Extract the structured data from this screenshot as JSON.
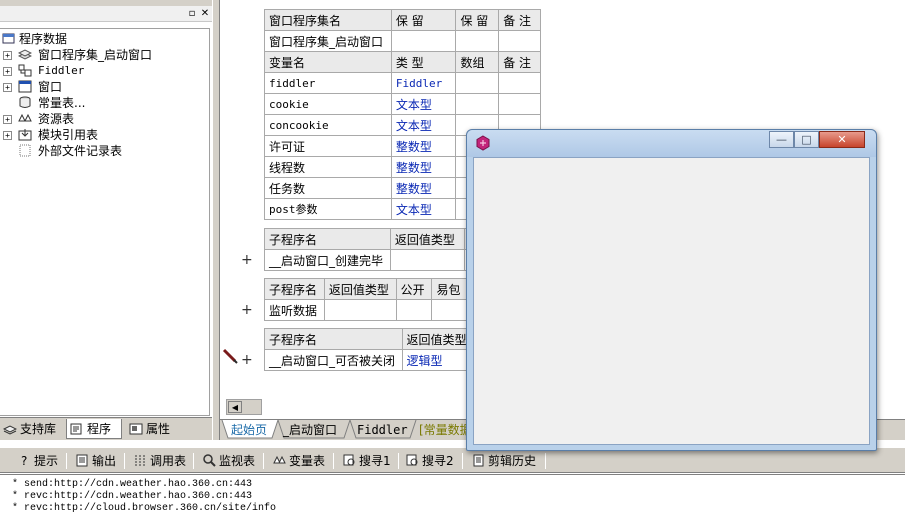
{
  "left_panel": {
    "tree": {
      "root": "程序数据",
      "items": [
        {
          "label": "窗口程序集_启动窗口",
          "icon": "assembly-icon",
          "expander": "+"
        },
        {
          "label": "Fiddler",
          "icon": "class-icon",
          "expander": "+"
        },
        {
          "label": "窗口",
          "icon": "window-icon",
          "expander": "+"
        },
        {
          "label": "常量表...",
          "icon": "constant-table-icon",
          "expander": ""
        },
        {
          "label": "资源表",
          "icon": "resource-icon",
          "expander": "+"
        },
        {
          "label": "模块引用表",
          "icon": "module-ref-icon",
          "expander": "+"
        },
        {
          "label": "外部文件记录表",
          "icon": "external-file-icon",
          "expander": ""
        }
      ]
    },
    "tabs": [
      {
        "label": "支持库",
        "icon": "library-icon"
      },
      {
        "label": "程序",
        "icon": "program-icon"
      },
      {
        "label": "属性",
        "icon": "property-icon"
      }
    ]
  },
  "code": {
    "assembly_table": {
      "headers": [
        "窗口程序集名",
        "保 留",
        "保 留",
        "备 注"
      ],
      "name": "窗口程序集_启动窗口"
    },
    "var_table": {
      "headers": [
        "变量名",
        "类 型",
        "数组",
        "备 注"
      ],
      "rows": [
        {
          "name": "fiddler",
          "type": "Fiddler"
        },
        {
          "name": "cookie",
          "type": "文本型"
        },
        {
          "name": "concookie",
          "type": "文本型"
        },
        {
          "name": "许可证",
          "type": "整数型"
        },
        {
          "name": "线程数",
          "type": "整数型"
        },
        {
          "name": "任务数",
          "type": "整数型"
        },
        {
          "name": "post参数",
          "type": "文本型"
        }
      ]
    },
    "sub1": {
      "headers": [
        "子程序名",
        "返回值类型"
      ],
      "name": "__启动窗口_创建完毕"
    },
    "sub2": {
      "headers": [
        "子程序名",
        "返回值类型",
        "公开",
        "易包"
      ],
      "name": "监听数据"
    },
    "sub3": {
      "headers": [
        "子程序名",
        "返回值类型"
      ],
      "name": "__启动窗口_可否被关闭",
      "return_type": "逻辑型"
    },
    "plus_sign": "+",
    "tabs": [
      "起始页",
      "_启动窗口",
      "Fiddler",
      "[常量数据"
    ]
  },
  "bottom_toolbar": {
    "buttons": [
      {
        "label": "提示",
        "icon": "hint-icon"
      },
      {
        "label": "输出",
        "icon": "output-icon"
      },
      {
        "label": "调用表",
        "icon": "call-table-icon"
      },
      {
        "label": "监视表",
        "icon": "watch-icon"
      },
      {
        "label": "变量表",
        "icon": "variable-table-icon"
      },
      {
        "label": "搜寻1",
        "icon": "search1-icon"
      },
      {
        "label": "搜寻2",
        "icon": "search2-icon"
      },
      {
        "label": "剪辑历史",
        "icon": "clipboard-history-icon"
      }
    ]
  },
  "output_lines": [
    "* send:http://cdn.weather.hao.360.cn:443",
    "* revc:http://cdn.weather.hao.360.cn:443",
    "* revc:http://cloud.browser.360.cn/site/info"
  ],
  "float_window": {
    "minimize": "—",
    "maximize": "□",
    "close": "✕"
  },
  "colors": {
    "type_blue": "#0a28b4",
    "header_gray": "#eaeaea",
    "chrome_gray": "#d4d0c8",
    "window_frame": "#b9d1ea"
  }
}
